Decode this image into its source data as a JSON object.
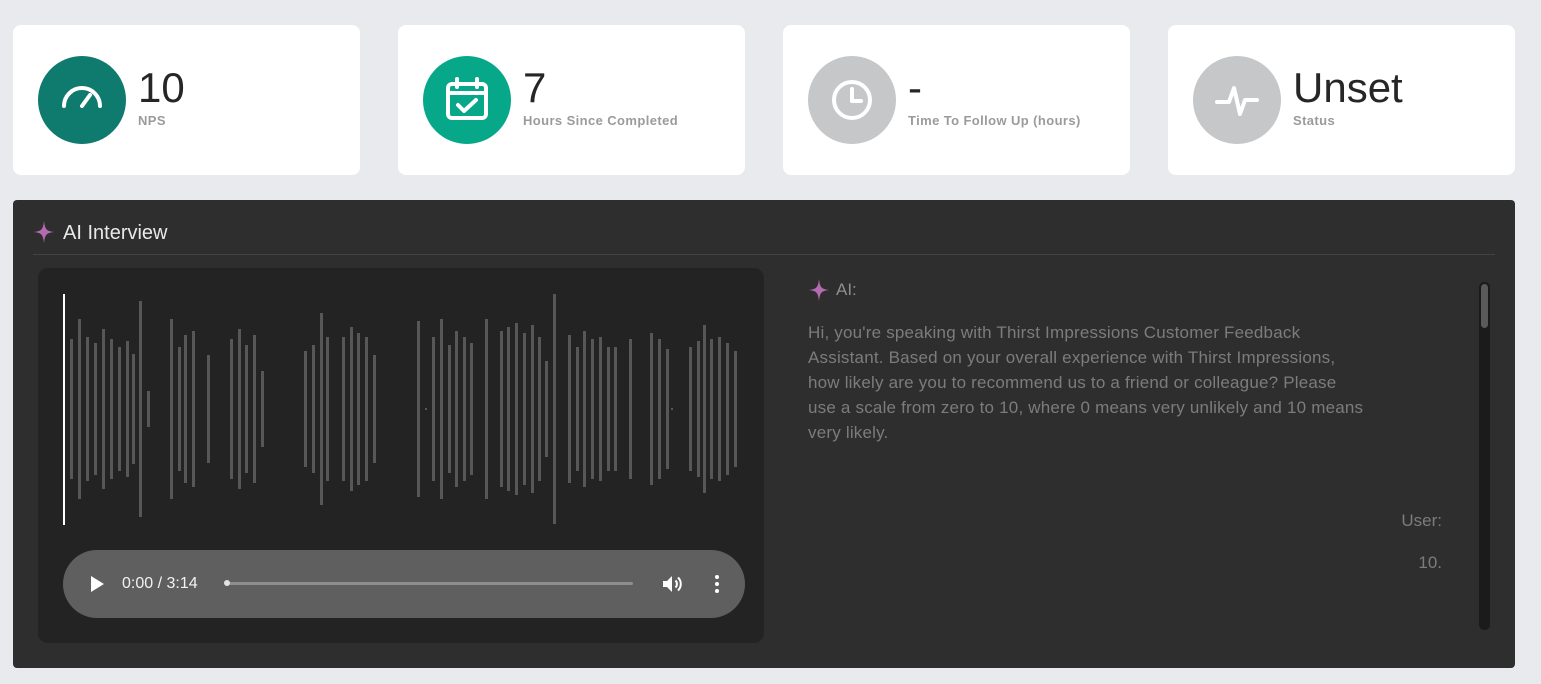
{
  "stats": [
    {
      "value": "10",
      "label": "NPS",
      "icon": "speedometer-icon",
      "color": "#0f7a6e"
    },
    {
      "value": "7",
      "label": "Hours Since Completed",
      "icon": "calendar-check-icon",
      "color": "#07a88a"
    },
    {
      "value": "-",
      "label": "Time To Follow Up (hours)",
      "icon": "clock-icon",
      "color": "#c6c7c9"
    },
    {
      "value": "Unset",
      "label": "Status",
      "icon": "pulse-icon",
      "color": "#c6c7c9"
    }
  ],
  "interview": {
    "title": "AI Interview",
    "audio": {
      "time": "0:00 / 3:14",
      "progress": 0
    },
    "transcript": {
      "ai_speaker": "AI:",
      "ai_message": "Hi, you're speaking with Thirst Impressions Customer Feedback Assistant. Based on your overall experience with Thirst Impressions, how likely are you to recommend us to a friend or colleague? Please use a scale from zero to 10, where 0 means very unlikely and 10 means very likely.",
      "user_speaker": "User:",
      "user_message": "10."
    }
  },
  "colors": {
    "accent_sparkle": "#b46bb0",
    "panel": "#2e2e2e"
  }
}
